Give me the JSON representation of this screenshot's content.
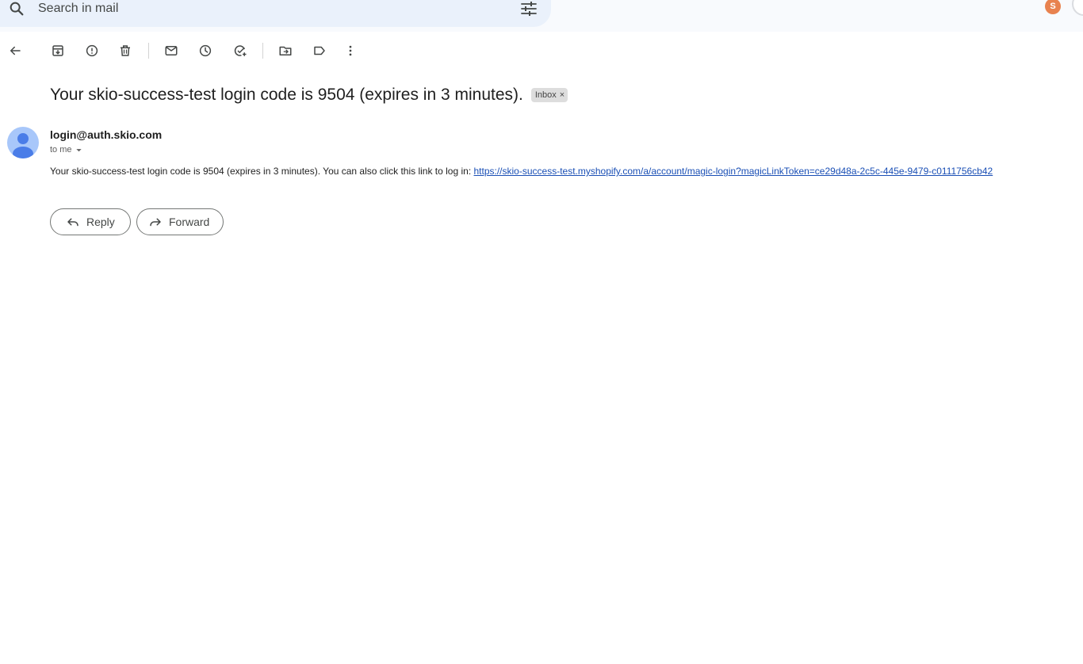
{
  "search": {
    "placeholder": "Search in mail"
  },
  "account": {
    "avatar_initial": "S"
  },
  "message": {
    "subject": "Your skio-success-test login code is 9504 (expires in 3 minutes).",
    "label": "Inbox",
    "label_remove": "×",
    "sender": "login@auth.skio.com",
    "recipient": "to me",
    "body_text": "Your skio-success-test login code is 9504 (expires in 3 minutes). You can also click this link to log in: ",
    "body_link": "https://skio-success-test.myshopify.com/a/account/magic-login?magicLinkToken=ce29d48a-2c5c-445e-9479-c0111756cb42"
  },
  "actions": {
    "reply": "Reply",
    "forward": "Forward"
  },
  "toolbar_icons": [
    "back-icon",
    "archive-icon",
    "report-spam-icon",
    "delete-icon",
    "mark-unread-icon",
    "snooze-icon",
    "add-task-icon",
    "move-to-icon",
    "labels-icon",
    "more-icon"
  ],
  "colors": {
    "link": "#1a4fb5",
    "search_bg": "#eaf1fb",
    "avatar_bg": "#a8c7fa",
    "avatar_fg": "#4a7de8",
    "account_avatar": "#e8824f"
  }
}
